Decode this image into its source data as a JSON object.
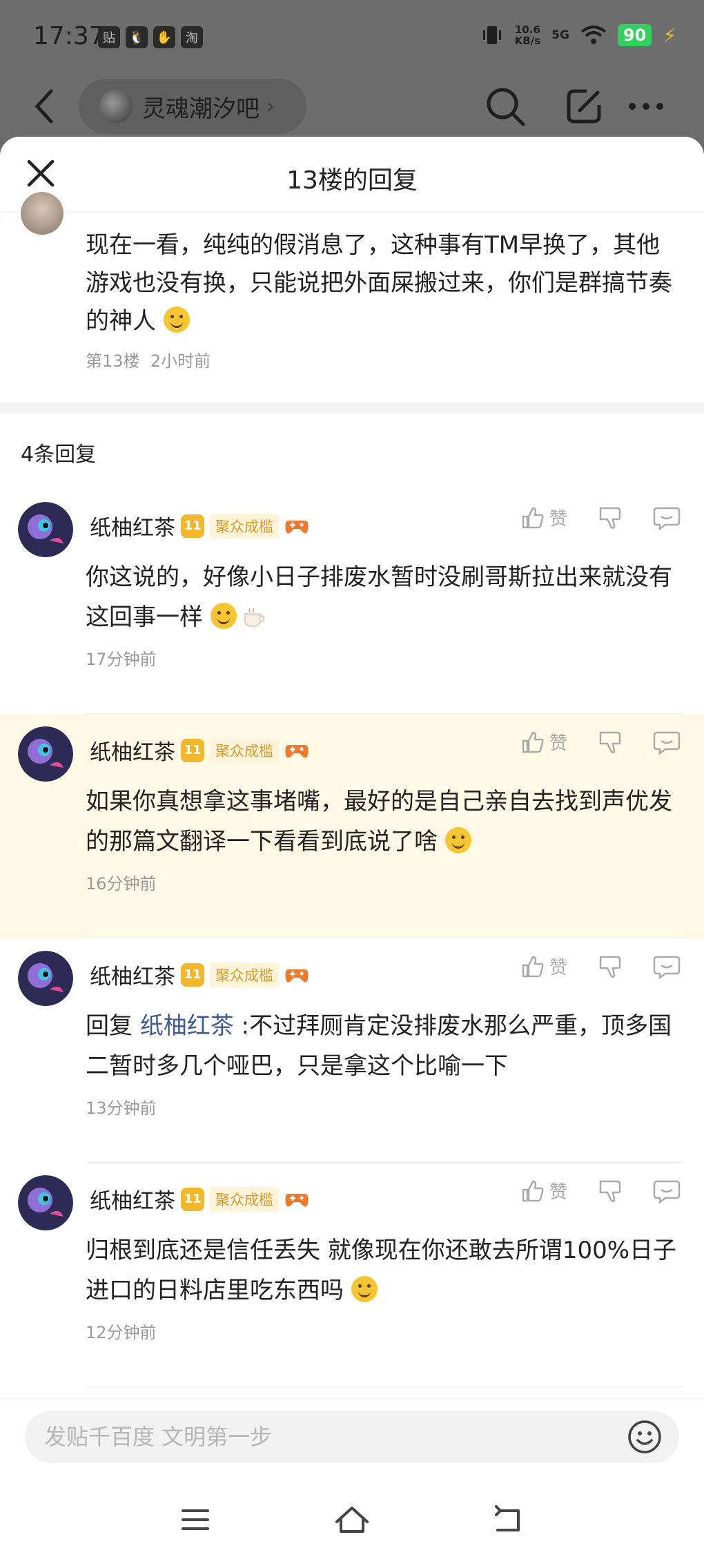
{
  "status": {
    "time": "17:37",
    "speed_top": "10.6",
    "speed_unit": "KB/s",
    "network": "5G",
    "battery": "90",
    "left_icons": [
      "贴",
      "🐧",
      "✋",
      "淘"
    ]
  },
  "header": {
    "forum_name": "灵魂潮汐吧"
  },
  "sheet": {
    "title": "13楼的回复"
  },
  "origin": {
    "text": "现在一看，纯纯的假消息了，这种事有TM早换了，其他游戏也没有换，只能说把外面屎搬过来，你们是群搞节奏的神人",
    "floor": "第13楼",
    "time": "2小时前"
  },
  "reply_count": "4条回复",
  "replies": [
    {
      "user": "纸柚红茶",
      "level": "11",
      "tag": "聚众成槛",
      "like": "赞",
      "text": "你这说的，好像小日子排废水暂时没刷哥斯拉出来就没有这回事一样",
      "time": "17分钟前"
    },
    {
      "user": "纸柚红茶",
      "level": "11",
      "tag": "聚众成槛",
      "like": "赞",
      "text": "如果你真想拿这事堵嘴，最好的是自己亲自去找到声优发的那篇文翻译一下看看到底说了啥",
      "time": "16分钟前"
    },
    {
      "user": "纸柚红茶",
      "level": "11",
      "tag": "聚众成槛",
      "like": "赞",
      "prefix": "回复",
      "mention": "纸柚红茶",
      "text": ":不过拜厕肯定没排废水那么严重，顶多国二暂时多几个哑巴，只是拿这个比喻一下",
      "time": "13分钟前"
    },
    {
      "user": "纸柚红茶",
      "level": "11",
      "tag": "聚众成槛",
      "like": "赞",
      "text": "归根到底还是信任丢失 就像现在你还敢去所谓100%日子进口的日料店里吃东西吗",
      "time": "12分钟前"
    }
  ],
  "input": {
    "placeholder": "发贴千百度 文明第一步"
  },
  "colors": {
    "highlight": "#fff9e6",
    "mention": "#3e5a94",
    "level_badge": "#f3b82a"
  }
}
